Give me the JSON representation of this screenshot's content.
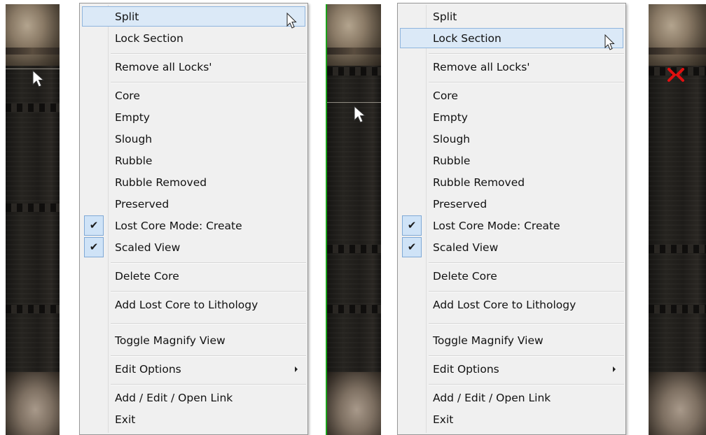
{
  "menu_left": {
    "highlighted": "Split",
    "items": [
      {
        "label": "Split"
      },
      {
        "label": "Lock Section"
      },
      {
        "label": "Remove all Locks'"
      },
      {
        "label": "Core"
      },
      {
        "label": "Empty"
      },
      {
        "label": "Slough"
      },
      {
        "label": "Rubble"
      },
      {
        "label": "Rubble Removed"
      },
      {
        "label": "Preserved"
      },
      {
        "label": "Lost Core Mode: Create",
        "checked": true
      },
      {
        "label": "Scaled View",
        "checked": true
      },
      {
        "label": "Delete Core"
      },
      {
        "label": "Add Lost Core to Lithology"
      },
      {
        "label": "Toggle Magnify View"
      },
      {
        "label": "Edit Options",
        "submenu": true
      },
      {
        "label": "Add / Edit / Open Link"
      },
      {
        "label": "Exit"
      }
    ]
  },
  "menu_right": {
    "highlighted": "Lock Section",
    "items": [
      {
        "label": "Split"
      },
      {
        "label": "Lock Section"
      },
      {
        "label": "Remove all Locks'"
      },
      {
        "label": "Core"
      },
      {
        "label": "Empty"
      },
      {
        "label": "Slough"
      },
      {
        "label": "Rubble"
      },
      {
        "label": "Rubble Removed"
      },
      {
        "label": "Preserved"
      },
      {
        "label": "Lost Core Mode: Create",
        "checked": true
      },
      {
        "label": "Scaled View",
        "checked": true
      },
      {
        "label": "Delete Core"
      },
      {
        "label": "Add Lost Core to Lithology"
      },
      {
        "label": "Toggle Magnify View"
      },
      {
        "label": "Edit Options",
        "submenu": true
      },
      {
        "label": "Add / Edit / Open Link"
      },
      {
        "label": "Exit"
      }
    ]
  },
  "checkmark_glyph": "✔",
  "colors": {
    "menu_bg": "#f0f0f0",
    "highlight_bg": "#dbe9f7",
    "highlight_border": "#8fb5dd",
    "check_bg": "#cfe3f7",
    "split_line_green": "#1aa31a",
    "lock_marker_red": "#e01010"
  },
  "icons": {
    "pointer": "arrow-cursor-icon",
    "hover_pointer": "hand-cursor-icon",
    "submenu": "submenu-arrow-icon",
    "check": "checkmark-icon",
    "lock": "lock-marker-icon"
  }
}
